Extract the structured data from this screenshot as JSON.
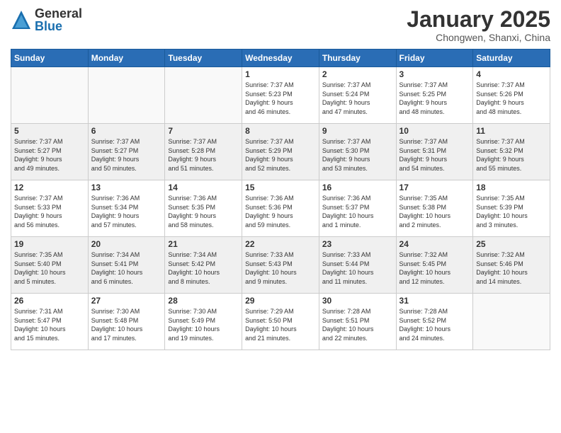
{
  "header": {
    "logo_general": "General",
    "logo_blue": "Blue",
    "month_title": "January 2025",
    "subtitle": "Chongwen, Shanxi, China"
  },
  "weekdays": [
    "Sunday",
    "Monday",
    "Tuesday",
    "Wednesday",
    "Thursday",
    "Friday",
    "Saturday"
  ],
  "weeks": [
    [
      {
        "day": "",
        "info": ""
      },
      {
        "day": "",
        "info": ""
      },
      {
        "day": "",
        "info": ""
      },
      {
        "day": "1",
        "info": "Sunrise: 7:37 AM\nSunset: 5:23 PM\nDaylight: 9 hours\nand 46 minutes."
      },
      {
        "day": "2",
        "info": "Sunrise: 7:37 AM\nSunset: 5:24 PM\nDaylight: 9 hours\nand 47 minutes."
      },
      {
        "day": "3",
        "info": "Sunrise: 7:37 AM\nSunset: 5:25 PM\nDaylight: 9 hours\nand 48 minutes."
      },
      {
        "day": "4",
        "info": "Sunrise: 7:37 AM\nSunset: 5:26 PM\nDaylight: 9 hours\nand 48 minutes."
      }
    ],
    [
      {
        "day": "5",
        "info": "Sunrise: 7:37 AM\nSunset: 5:27 PM\nDaylight: 9 hours\nand 49 minutes."
      },
      {
        "day": "6",
        "info": "Sunrise: 7:37 AM\nSunset: 5:27 PM\nDaylight: 9 hours\nand 50 minutes."
      },
      {
        "day": "7",
        "info": "Sunrise: 7:37 AM\nSunset: 5:28 PM\nDaylight: 9 hours\nand 51 minutes."
      },
      {
        "day": "8",
        "info": "Sunrise: 7:37 AM\nSunset: 5:29 PM\nDaylight: 9 hours\nand 52 minutes."
      },
      {
        "day": "9",
        "info": "Sunrise: 7:37 AM\nSunset: 5:30 PM\nDaylight: 9 hours\nand 53 minutes."
      },
      {
        "day": "10",
        "info": "Sunrise: 7:37 AM\nSunset: 5:31 PM\nDaylight: 9 hours\nand 54 minutes."
      },
      {
        "day": "11",
        "info": "Sunrise: 7:37 AM\nSunset: 5:32 PM\nDaylight: 9 hours\nand 55 minutes."
      }
    ],
    [
      {
        "day": "12",
        "info": "Sunrise: 7:37 AM\nSunset: 5:33 PM\nDaylight: 9 hours\nand 56 minutes."
      },
      {
        "day": "13",
        "info": "Sunrise: 7:36 AM\nSunset: 5:34 PM\nDaylight: 9 hours\nand 57 minutes."
      },
      {
        "day": "14",
        "info": "Sunrise: 7:36 AM\nSunset: 5:35 PM\nDaylight: 9 hours\nand 58 minutes."
      },
      {
        "day": "15",
        "info": "Sunrise: 7:36 AM\nSunset: 5:36 PM\nDaylight: 9 hours\nand 59 minutes."
      },
      {
        "day": "16",
        "info": "Sunrise: 7:36 AM\nSunset: 5:37 PM\nDaylight: 10 hours\nand 1 minute."
      },
      {
        "day": "17",
        "info": "Sunrise: 7:35 AM\nSunset: 5:38 PM\nDaylight: 10 hours\nand 2 minutes."
      },
      {
        "day": "18",
        "info": "Sunrise: 7:35 AM\nSunset: 5:39 PM\nDaylight: 10 hours\nand 3 minutes."
      }
    ],
    [
      {
        "day": "19",
        "info": "Sunrise: 7:35 AM\nSunset: 5:40 PM\nDaylight: 10 hours\nand 5 minutes."
      },
      {
        "day": "20",
        "info": "Sunrise: 7:34 AM\nSunset: 5:41 PM\nDaylight: 10 hours\nand 6 minutes."
      },
      {
        "day": "21",
        "info": "Sunrise: 7:34 AM\nSunset: 5:42 PM\nDaylight: 10 hours\nand 8 minutes."
      },
      {
        "day": "22",
        "info": "Sunrise: 7:33 AM\nSunset: 5:43 PM\nDaylight: 10 hours\nand 9 minutes."
      },
      {
        "day": "23",
        "info": "Sunrise: 7:33 AM\nSunset: 5:44 PM\nDaylight: 10 hours\nand 11 minutes."
      },
      {
        "day": "24",
        "info": "Sunrise: 7:32 AM\nSunset: 5:45 PM\nDaylight: 10 hours\nand 12 minutes."
      },
      {
        "day": "25",
        "info": "Sunrise: 7:32 AM\nSunset: 5:46 PM\nDaylight: 10 hours\nand 14 minutes."
      }
    ],
    [
      {
        "day": "26",
        "info": "Sunrise: 7:31 AM\nSunset: 5:47 PM\nDaylight: 10 hours\nand 15 minutes."
      },
      {
        "day": "27",
        "info": "Sunrise: 7:30 AM\nSunset: 5:48 PM\nDaylight: 10 hours\nand 17 minutes."
      },
      {
        "day": "28",
        "info": "Sunrise: 7:30 AM\nSunset: 5:49 PM\nDaylight: 10 hours\nand 19 minutes."
      },
      {
        "day": "29",
        "info": "Sunrise: 7:29 AM\nSunset: 5:50 PM\nDaylight: 10 hours\nand 21 minutes."
      },
      {
        "day": "30",
        "info": "Sunrise: 7:28 AM\nSunset: 5:51 PM\nDaylight: 10 hours\nand 22 minutes."
      },
      {
        "day": "31",
        "info": "Sunrise: 7:28 AM\nSunset: 5:52 PM\nDaylight: 10 hours\nand 24 minutes."
      },
      {
        "day": "",
        "info": ""
      }
    ]
  ]
}
